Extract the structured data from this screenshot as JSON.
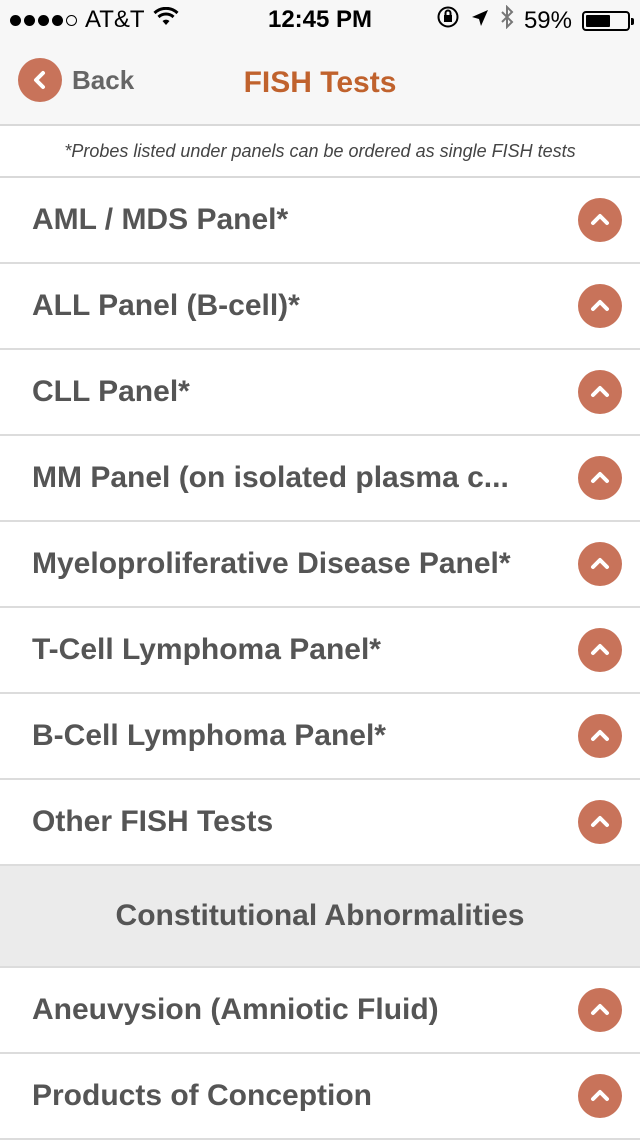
{
  "status_bar": {
    "carrier": "AT&T",
    "time": "12:45 PM",
    "battery": "59%",
    "battery_level": 0.59,
    "signal_bars_filled": 4,
    "signal_bars_total": 5,
    "icons": [
      "wifi-icon",
      "orientation-lock-icon",
      "location-arrow-icon",
      "bluetooth-icon",
      "battery-icon"
    ]
  },
  "nav": {
    "back_label": "Back",
    "title": "FISH Tests"
  },
  "note": "*Probes listed under panels can be ordered as single FISH tests",
  "colors": {
    "accent": "#c8735a",
    "title": "#c0622d",
    "text": "#555555",
    "section_bg": "#ebebeb"
  },
  "panels": [
    {
      "label": "AML / MDS Panel*"
    },
    {
      "label": "ALL Panel (B-cell)*"
    },
    {
      "label": "CLL Panel*"
    },
    {
      "label": "MM Panel (on isolated plasma c..."
    },
    {
      "label": "Myeloproliferative Disease Panel*"
    },
    {
      "label": "T-Cell Lymphoma Panel*"
    },
    {
      "label": "B-Cell Lymphoma Panel*"
    },
    {
      "label": "Other FISH Tests"
    }
  ],
  "section": {
    "title": "Constitutional Abnormalities",
    "items": [
      {
        "label": "Aneuvysion (Amniotic Fluid)"
      },
      {
        "label": "Products of Conception"
      }
    ]
  }
}
